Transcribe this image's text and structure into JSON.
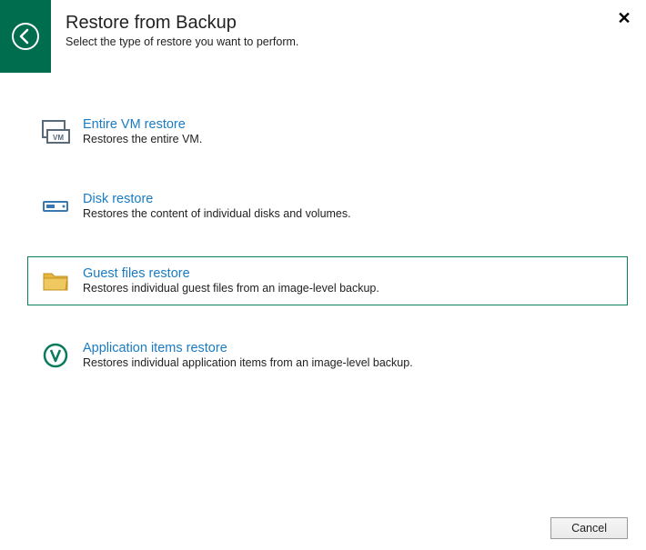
{
  "header": {
    "title": "Restore from Backup",
    "subtitle": "Select the type of restore you want to perform."
  },
  "options": {
    "vm": {
      "title": "Entire VM restore",
      "desc": "Restores the entire VM."
    },
    "disk": {
      "title": "Disk restore",
      "desc": "Restores the content of individual disks and volumes."
    },
    "guest": {
      "title": "Guest files restore",
      "desc": "Restores individual guest files from an image-level backup."
    },
    "app": {
      "title": "Application items restore",
      "desc": "Restores individual application items from an image-level backup."
    }
  },
  "footer": {
    "cancel_label": "Cancel"
  }
}
